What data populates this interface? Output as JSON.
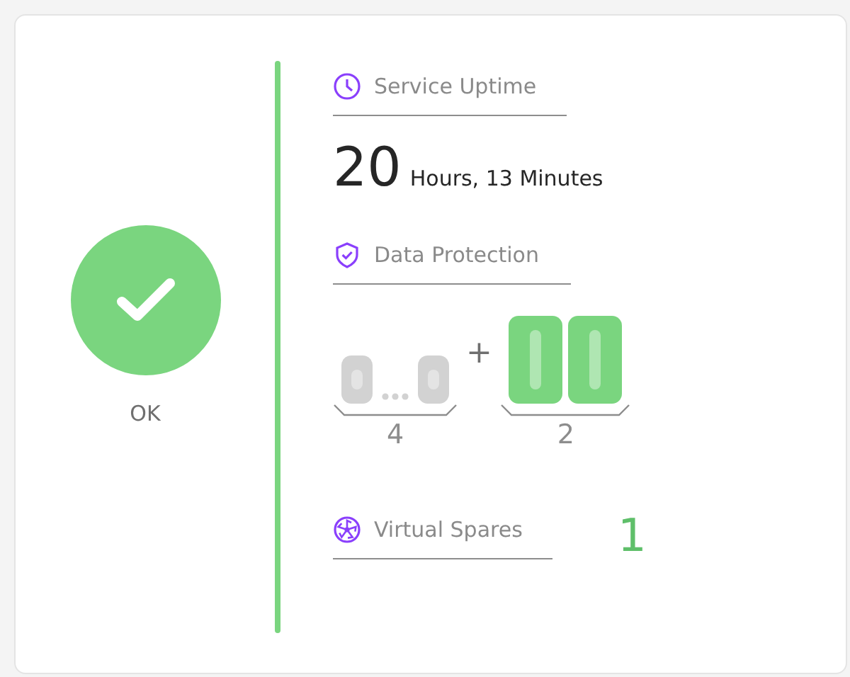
{
  "status": {
    "healthy": true,
    "label": "OK"
  },
  "uptime": {
    "title": "Service Uptime",
    "value": "20",
    "unit": "Hours, 13 Minutes"
  },
  "protection": {
    "title": "Data Protection",
    "operator": "+",
    "groups": [
      {
        "kind": "range",
        "active": false,
        "count": "4"
      },
      {
        "kind": "pair",
        "active": true,
        "count": "2"
      }
    ]
  },
  "spares": {
    "title": "Virtual Spares",
    "value": "1"
  }
}
